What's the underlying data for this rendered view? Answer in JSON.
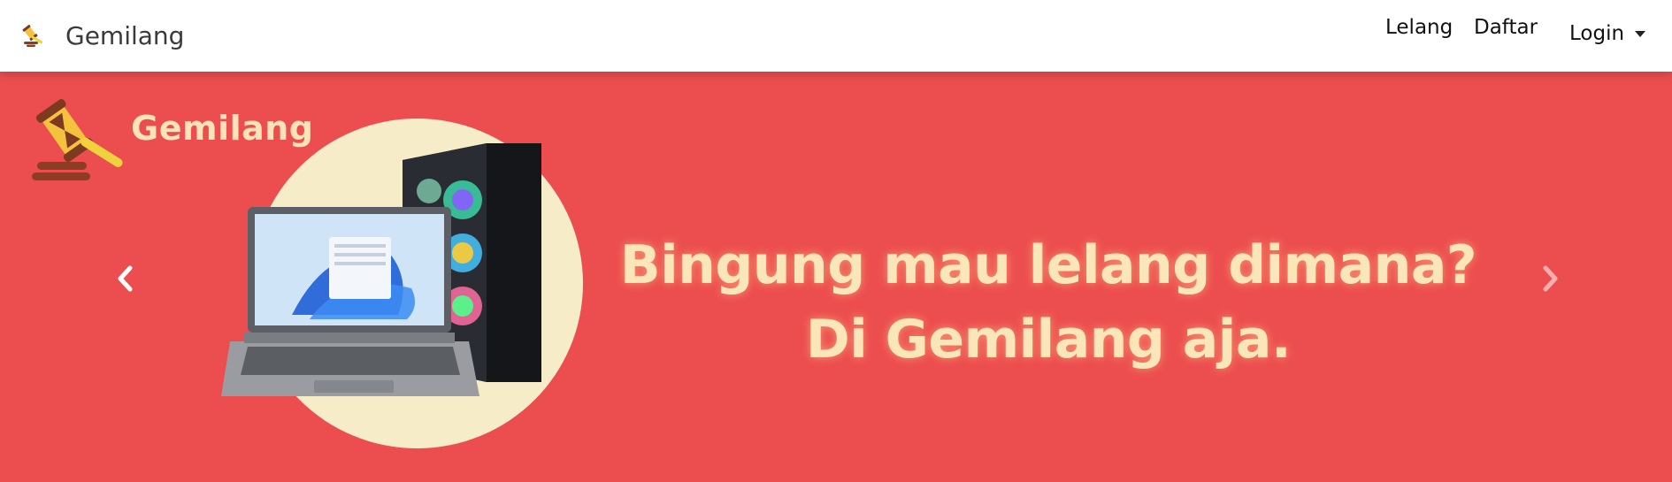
{
  "navbar": {
    "brand_name": "Gemilang",
    "brand_logo_icon": "gavel-icon",
    "links": {
      "lelang": "Lelang",
      "daftar": "Daftar",
      "login": "Login"
    },
    "login_dropdown_icon": "caret-down-icon"
  },
  "carousel": {
    "slide": {
      "brand_name": "Gemilang",
      "headline_line1": "Bingung mau lelang dimana?",
      "headline_line2": "Di Gemilang aja.",
      "image": "laptop-and-pc-illustration"
    },
    "prev_icon": "chevron-left-icon",
    "next_icon": "chevron-right-icon"
  },
  "colors": {
    "hero_background": "#ec4e4f",
    "headline_color": "#fbe6ba",
    "circle_color": "#f6ecc8"
  }
}
